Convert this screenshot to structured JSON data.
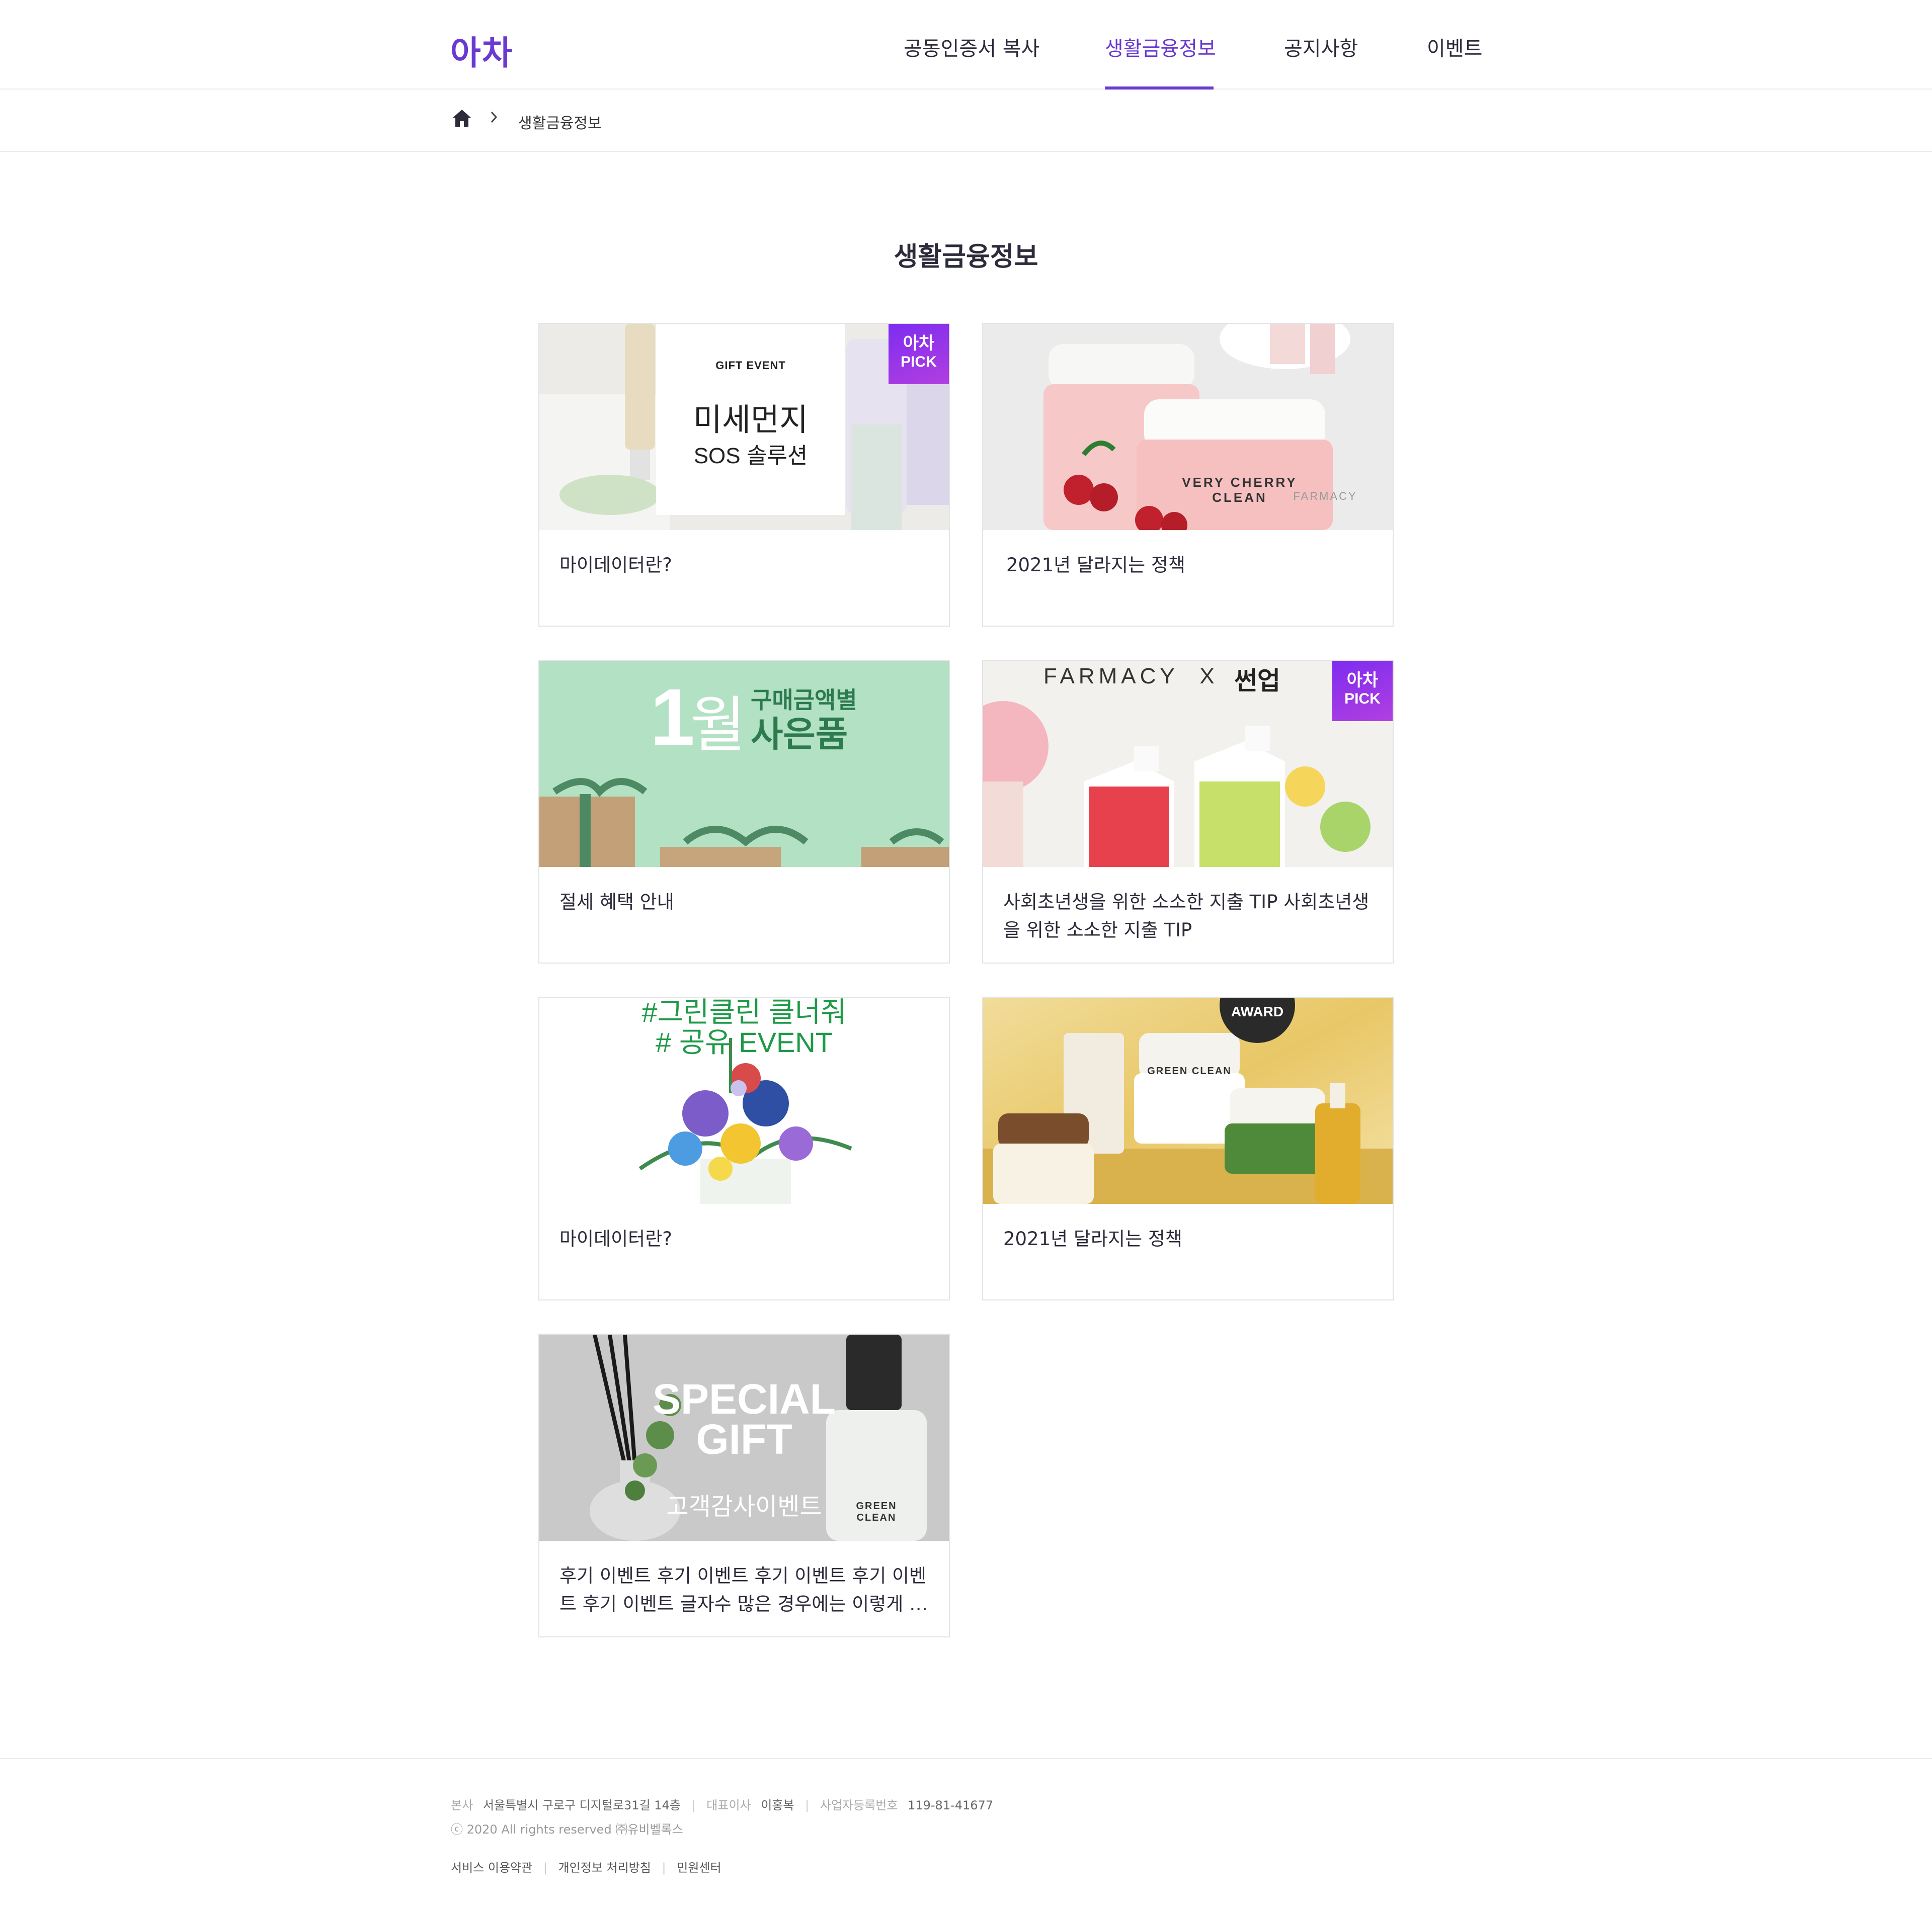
{
  "header": {
    "logo": "아차",
    "nav": [
      {
        "label": "공동인증서 복사",
        "active": false
      },
      {
        "label": "생활금융정보",
        "active": true
      },
      {
        "label": "공지사항",
        "active": false
      },
      {
        "label": "이벤트",
        "active": false
      }
    ]
  },
  "breadcrumb": {
    "home_icon": "home-icon",
    "separator": ">",
    "current": "생활금융정보"
  },
  "page_title": "생활금융정보",
  "badge": {
    "line1": "아차",
    "line2": "PICK"
  },
  "cards": [
    {
      "title": "마이데이터란?",
      "pick": true,
      "thumb": {
        "line_small": "GIFT EVENT",
        "line_big": "미세먼지",
        "line_mid": "SOS 솔루션"
      }
    },
    {
      "title": "2021년 달라지는 정책",
      "pick": false,
      "thumb": {
        "label": "VERY CHERRY",
        "label2": "CLEAN",
        "brand": "FARMACY"
      }
    },
    {
      "title": "절세 혜택 안내",
      "pick": false,
      "thumb": {
        "num": "1",
        "month": "월",
        "l1": "구매금액별",
        "l2": "사은품"
      }
    },
    {
      "title": "사회초년생을 위한 소소한 지출 TIP 사회초년생을 위한 소소한 지출 TIP",
      "pick": true,
      "thumb": {
        "brand": "FARMACY",
        "x": "X",
        "partner": "썬업"
      }
    },
    {
      "title": "마이데이터란?",
      "pick": false,
      "thumb": {
        "l1": "#그린클린 클너줘",
        "l2": "# 공유 EVENT"
      }
    },
    {
      "title": "2021년 달라지는 정책",
      "pick": false,
      "thumb": {
        "award": "AWARD",
        "jar": "GREEN CLEAN"
      }
    },
    {
      "title": "후기 이벤트 후기 이벤트 후기 이벤트 후기 이벤트 후기 이벤트 글자수 많은 경우에는 이렇게 보여지게 됩니다",
      "pick": false,
      "thumb": {
        "l1": "SPECIAL",
        "l2": "GIFT",
        "l3": "고객감사이벤트",
        "bottle": "GREEN CLEAN"
      }
    }
  ],
  "footer": {
    "hq_label": "본사",
    "hq_value": "서울특별시 구로구 디지털로31길 14층",
    "ceo_label": "대표이사",
    "ceo_value": "이홍복",
    "biz_label": "사업자등록번호",
    "biz_value": "119-81-41677",
    "copyright": "ⓒ 2020 All rights reserved ㈜유비벨록스",
    "links": [
      "서비스 이용약관",
      "개인정보 처리방침",
      "민원센터"
    ]
  },
  "colors": {
    "accent": "#6a3ad0",
    "text": "#2b2b3a",
    "border": "#e3e3e8"
  }
}
